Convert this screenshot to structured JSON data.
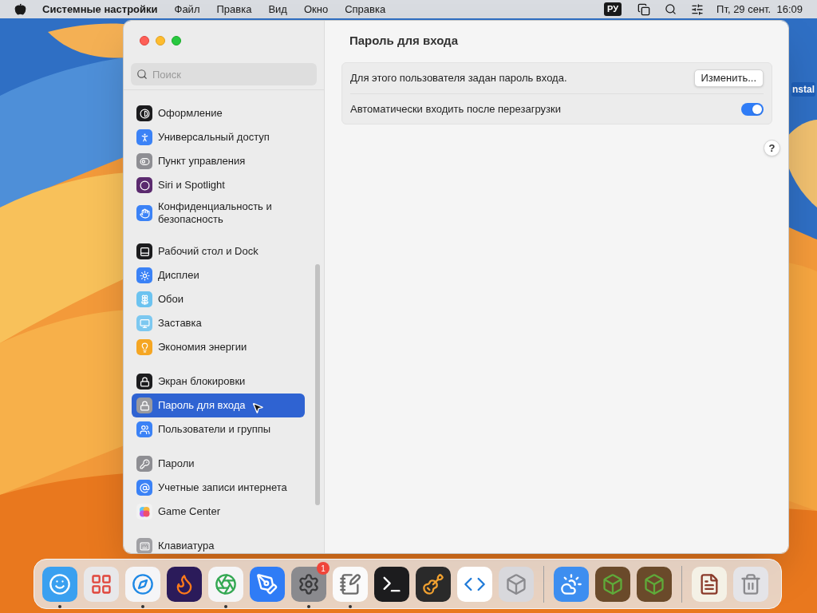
{
  "menubar": {
    "app": "Системные настройки",
    "menus": [
      "Файл",
      "Правка",
      "Вид",
      "Окно",
      "Справка"
    ],
    "input_source": "РУ",
    "datetime": "Пт, 29 сент.  16:09"
  },
  "desktop": {
    "file_label": "nstal"
  },
  "window": {
    "search": {
      "placeholder": "Поиск"
    },
    "sidebar": {
      "groups": [
        [
          {
            "label": "Оформление",
            "selected": false
          },
          {
            "label": "Универсальный доступ",
            "selected": false
          },
          {
            "label": "Пункт управления",
            "selected": false
          },
          {
            "label": "Siri и Spotlight",
            "selected": false
          },
          {
            "label": "Конфиденциальность и безопасность",
            "selected": false
          }
        ],
        [
          {
            "label": "Рабочий стол и Dock",
            "selected": false
          },
          {
            "label": "Дисплеи",
            "selected": false
          },
          {
            "label": "Обои",
            "selected": false
          },
          {
            "label": "Заставка",
            "selected": false
          },
          {
            "label": "Экономия энергии",
            "selected": false
          }
        ],
        [
          {
            "label": "Экран блокировки",
            "selected": false
          },
          {
            "label": "Пароль для входа",
            "selected": true
          },
          {
            "label": "Пользователи и группы",
            "selected": false
          }
        ],
        [
          {
            "label": "Пароли",
            "selected": false
          },
          {
            "label": "Учетные записи интернета",
            "selected": false
          },
          {
            "label": "Game Center",
            "selected": false
          }
        ],
        [
          {
            "label": "Клавиатура",
            "selected": false
          }
        ]
      ]
    },
    "content": {
      "title": "Пароль для входа",
      "rows": [
        {
          "kind": "button",
          "label": "Для этого пользователя задан пароль входа.",
          "button": "Изменить..."
        },
        {
          "kind": "toggle",
          "label": "Автоматически входить после перезагрузки",
          "on": true
        }
      ],
      "help": "?"
    }
  },
  "dock": {
    "items": [
      {
        "kind": "app",
        "running": true
      },
      {
        "kind": "app",
        "running": false
      },
      {
        "kind": "app",
        "running": true
      },
      {
        "kind": "app",
        "running": false
      },
      {
        "kind": "app",
        "running": true
      },
      {
        "kind": "app",
        "running": false
      },
      {
        "kind": "app",
        "running": true,
        "badge": "1"
      },
      {
        "kind": "app",
        "running": true
      },
      {
        "kind": "app",
        "running": false
      },
      {
        "kind": "app",
        "running": false
      },
      {
        "kind": "app",
        "running": false
      },
      {
        "kind": "app",
        "running": false
      },
      {
        "kind": "separator"
      },
      {
        "kind": "app",
        "running": false
      },
      {
        "kind": "app",
        "running": false
      },
      {
        "kind": "app",
        "running": false
      },
      {
        "kind": "separator"
      },
      {
        "kind": "app",
        "running": false
      },
      {
        "kind": "app",
        "running": false
      }
    ]
  }
}
